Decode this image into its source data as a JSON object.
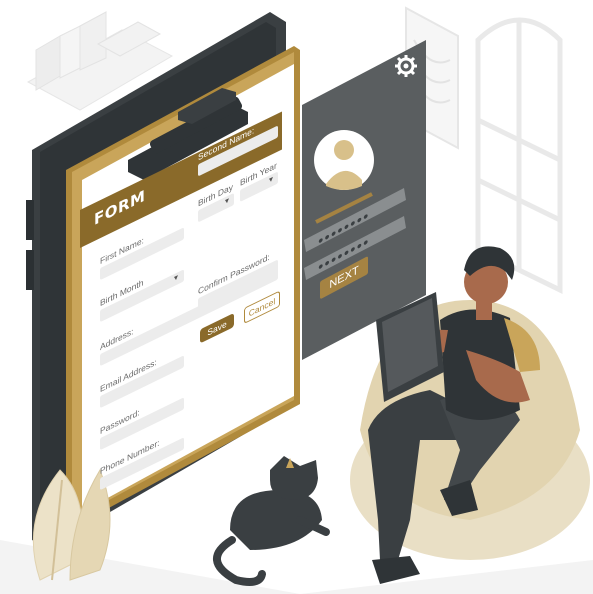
{
  "form": {
    "title": "FORM",
    "labels": {
      "first_name": "First Name:",
      "second_name": "Second Name:",
      "birth_month": "Birth Month",
      "birth_day": "Birth Day",
      "birth_year": "Birth Year",
      "address": "Address:",
      "email": "Email Address:",
      "confirm_password": "Confirm Password:",
      "password": "Password:",
      "phone": "Phone Number:"
    },
    "save_label": "Save",
    "cancel_label": "Cancel"
  },
  "login": {
    "password_mask_1": "●●●●●●●●",
    "password_mask_2": "●●●●●●●●",
    "next_label": "NEXT"
  },
  "icons": [
    "gear-icon",
    "user-avatar-icon",
    "clipboard-clip-icon"
  ],
  "colors": {
    "brand_brown": "#8a6a2a",
    "light_tan": "#e8dcc0",
    "dark_slate": "#3a3f42",
    "panel_grey": "#5a5e60",
    "accent_gold": "#a58342"
  }
}
